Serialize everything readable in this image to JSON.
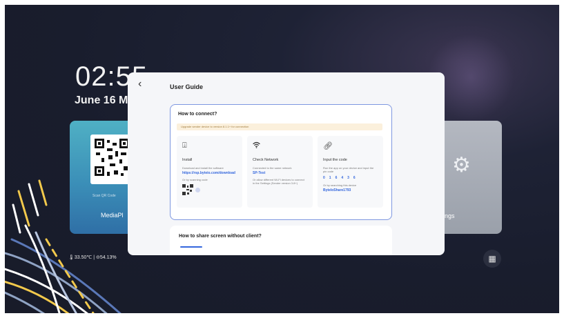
{
  "home": {
    "clock": "02:55",
    "date": "June 16  M",
    "media_card_label": "MediaPl",
    "media_qr_caption": "Scan QR Code",
    "settings_card_label": "ttings",
    "status_text": "🌡33.50℃ | ⊝54.13%",
    "apps_icon": "apps-grid-icon"
  },
  "modal": {
    "back_icon": "‹",
    "title": "User Guide",
    "connect": {
      "title": "How to connect?",
      "notice": "Upgrade sender device to version 8.1.1+ for connection",
      "steps": [
        {
          "icon": "download-icon",
          "title": "Install",
          "text": "Download and install the software",
          "link": "https://rsp.byteio.com/download",
          "extra": "Or by scanning code"
        },
        {
          "icon": "wifi-icon",
          "title": "Check Network",
          "text": "Connected to the same network",
          "link": "SP-Test",
          "extra": "Or allow different Wi-Fi devices to connect in the Settings (Sender version 3.8+)"
        },
        {
          "icon": "link-icon",
          "title": "Input the code",
          "text": "Run the app on your device and input the pin code",
          "digits": [
            "0",
            "1",
            "6",
            "4",
            "3",
            "6"
          ],
          "extra": "Or by searching this device",
          "link": "ByteIoShare1793"
        }
      ]
    },
    "share": {
      "title": "How to share screen without client?"
    }
  }
}
